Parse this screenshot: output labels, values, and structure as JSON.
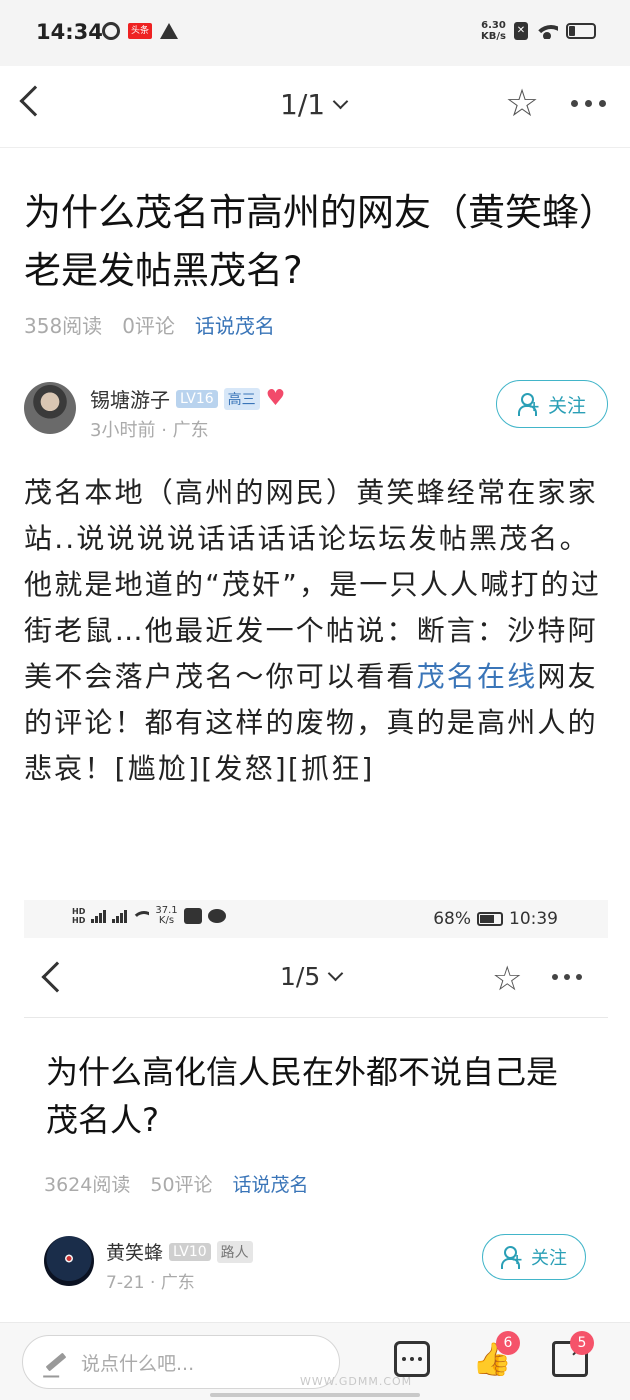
{
  "status_bar": {
    "time": "14:34",
    "app_badge": "头条",
    "net_speed_value": "6.30",
    "net_speed_unit": "KB/s",
    "battery_level": 0.25
  },
  "nav": {
    "page_indicator": "1/1"
  },
  "post": {
    "title": "为什么茂名市高州的网友（黄笑蜂）老是发帖黑茂名?",
    "reads": "358阅读",
    "comments": "0评论",
    "topic": "话说茂名"
  },
  "author": {
    "name": "锡塘游子",
    "level": "LV16",
    "grade": "高三",
    "time": "3小时前",
    "location": "广东",
    "follow_label": "关注"
  },
  "body": {
    "part1": "茂名本地（高州的网民）黄笑蜂经常在家家站..说说说说话话话话论坛坛发帖黑茂名。他就是地道的“茂奸”，是一只人人喊打的过街老鼠…他最近发一个帖说：断言：沙特阿美不会落户茂名～你可以看看",
    "link": "茂名在线",
    "part2": "网友的评论！都有这样的废物，真的是高州人的悲哀！[尴尬][发怒][抓狂]"
  },
  "embedded": {
    "status_speed_value": "37.1",
    "status_speed_unit": "K/s",
    "battery": "68%",
    "time": "10:39",
    "page_indicator": "1/5",
    "title": "为什么高化信人民在外都不说自己是茂名人?",
    "reads": "3624阅读",
    "comments": "50评论",
    "topic": "话说茂名",
    "author_name": "黄笑蜂",
    "author_level": "LV10",
    "author_grade": "路人",
    "author_time": "7-21",
    "author_location": "广东",
    "follow_label": "关注"
  },
  "bottom_bar": {
    "comment_placeholder": "说点什么吧...",
    "like_count": "6",
    "share_count": "5",
    "watermark": "WWW.GDMM.COM"
  }
}
